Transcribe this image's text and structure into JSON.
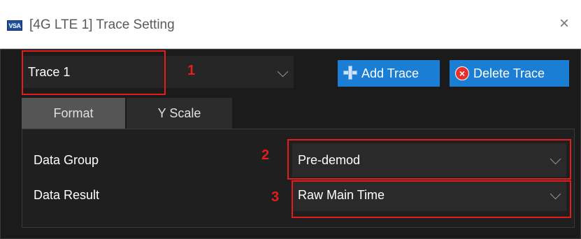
{
  "window": {
    "app_icon_text": "VSA",
    "title": "[4G LTE 1] Trace Setting",
    "close_glyph": "×"
  },
  "trace": {
    "selected": "Trace 1"
  },
  "toolbar": {
    "add_trace_label": "Add Trace",
    "delete_trace_label": "Delete Trace",
    "delete_glyph": "×"
  },
  "tabs": [
    {
      "label": "Format",
      "active": true
    },
    {
      "label": "Y Scale",
      "active": false
    }
  ],
  "format": {
    "data_group_label": "Data Group",
    "data_group_value": "Pre-demod",
    "data_result_label": "Data Result",
    "data_result_value": "Raw Main Time"
  },
  "annotations": [
    "1",
    "2",
    "3"
  ],
  "colors": {
    "panel_bg": "#1b1b1b",
    "button_blue": "#1a7fd4",
    "annotation_red": "#e31d1d"
  }
}
